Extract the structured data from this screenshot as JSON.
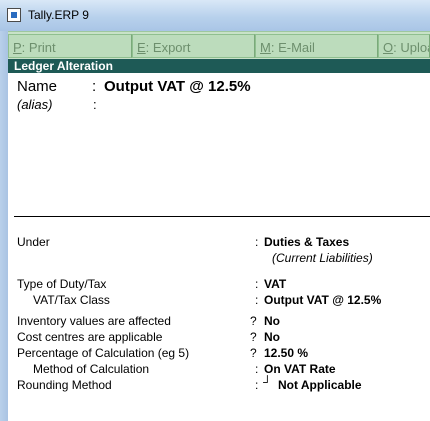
{
  "window": {
    "title": "Tally.ERP 9"
  },
  "toolbar": {
    "buttons": [
      {
        "key": "P",
        "rest": ": Print"
      },
      {
        "key": "E",
        "rest": ": Export"
      },
      {
        "key": "M",
        "rest": ": E-Mail"
      },
      {
        "key": "O",
        "rest": ": Uploa"
      }
    ]
  },
  "screen": {
    "header": "Ledger Alteration"
  },
  "ledger": {
    "name_label": "Name",
    "name_sep": ":",
    "name_value": "Output VAT @ 12.5%",
    "alias_label": "(alias)",
    "alias_sep": ":"
  },
  "fields": {
    "under": {
      "label": "Under",
      "sep": ":",
      "value": "Duties & Taxes",
      "sub": "(Current Liabilities)"
    },
    "duty_type": {
      "label": "Type of Duty/Tax",
      "sep": ":",
      "value": "VAT"
    },
    "vat_class": {
      "label": "VAT/Tax Class",
      "sep": ":",
      "value": "Output VAT @ 12.5%"
    },
    "inventory": {
      "label": "Inventory values are affected",
      "sep": "?",
      "value": "No"
    },
    "cost_centres": {
      "label": "Cost centres are applicable",
      "sep": "?",
      "value": "No"
    },
    "percentage": {
      "label": "Percentage of Calculation (eg 5)",
      "sep": "?",
      "value": "12.50 %"
    },
    "method": {
      "label": "Method of Calculation",
      "sep": ":",
      "value": "On VAT Rate"
    },
    "rounding": {
      "label": "Rounding Method",
      "sep": ":",
      "marker": "┘",
      "value": "Not Applicable"
    }
  }
}
